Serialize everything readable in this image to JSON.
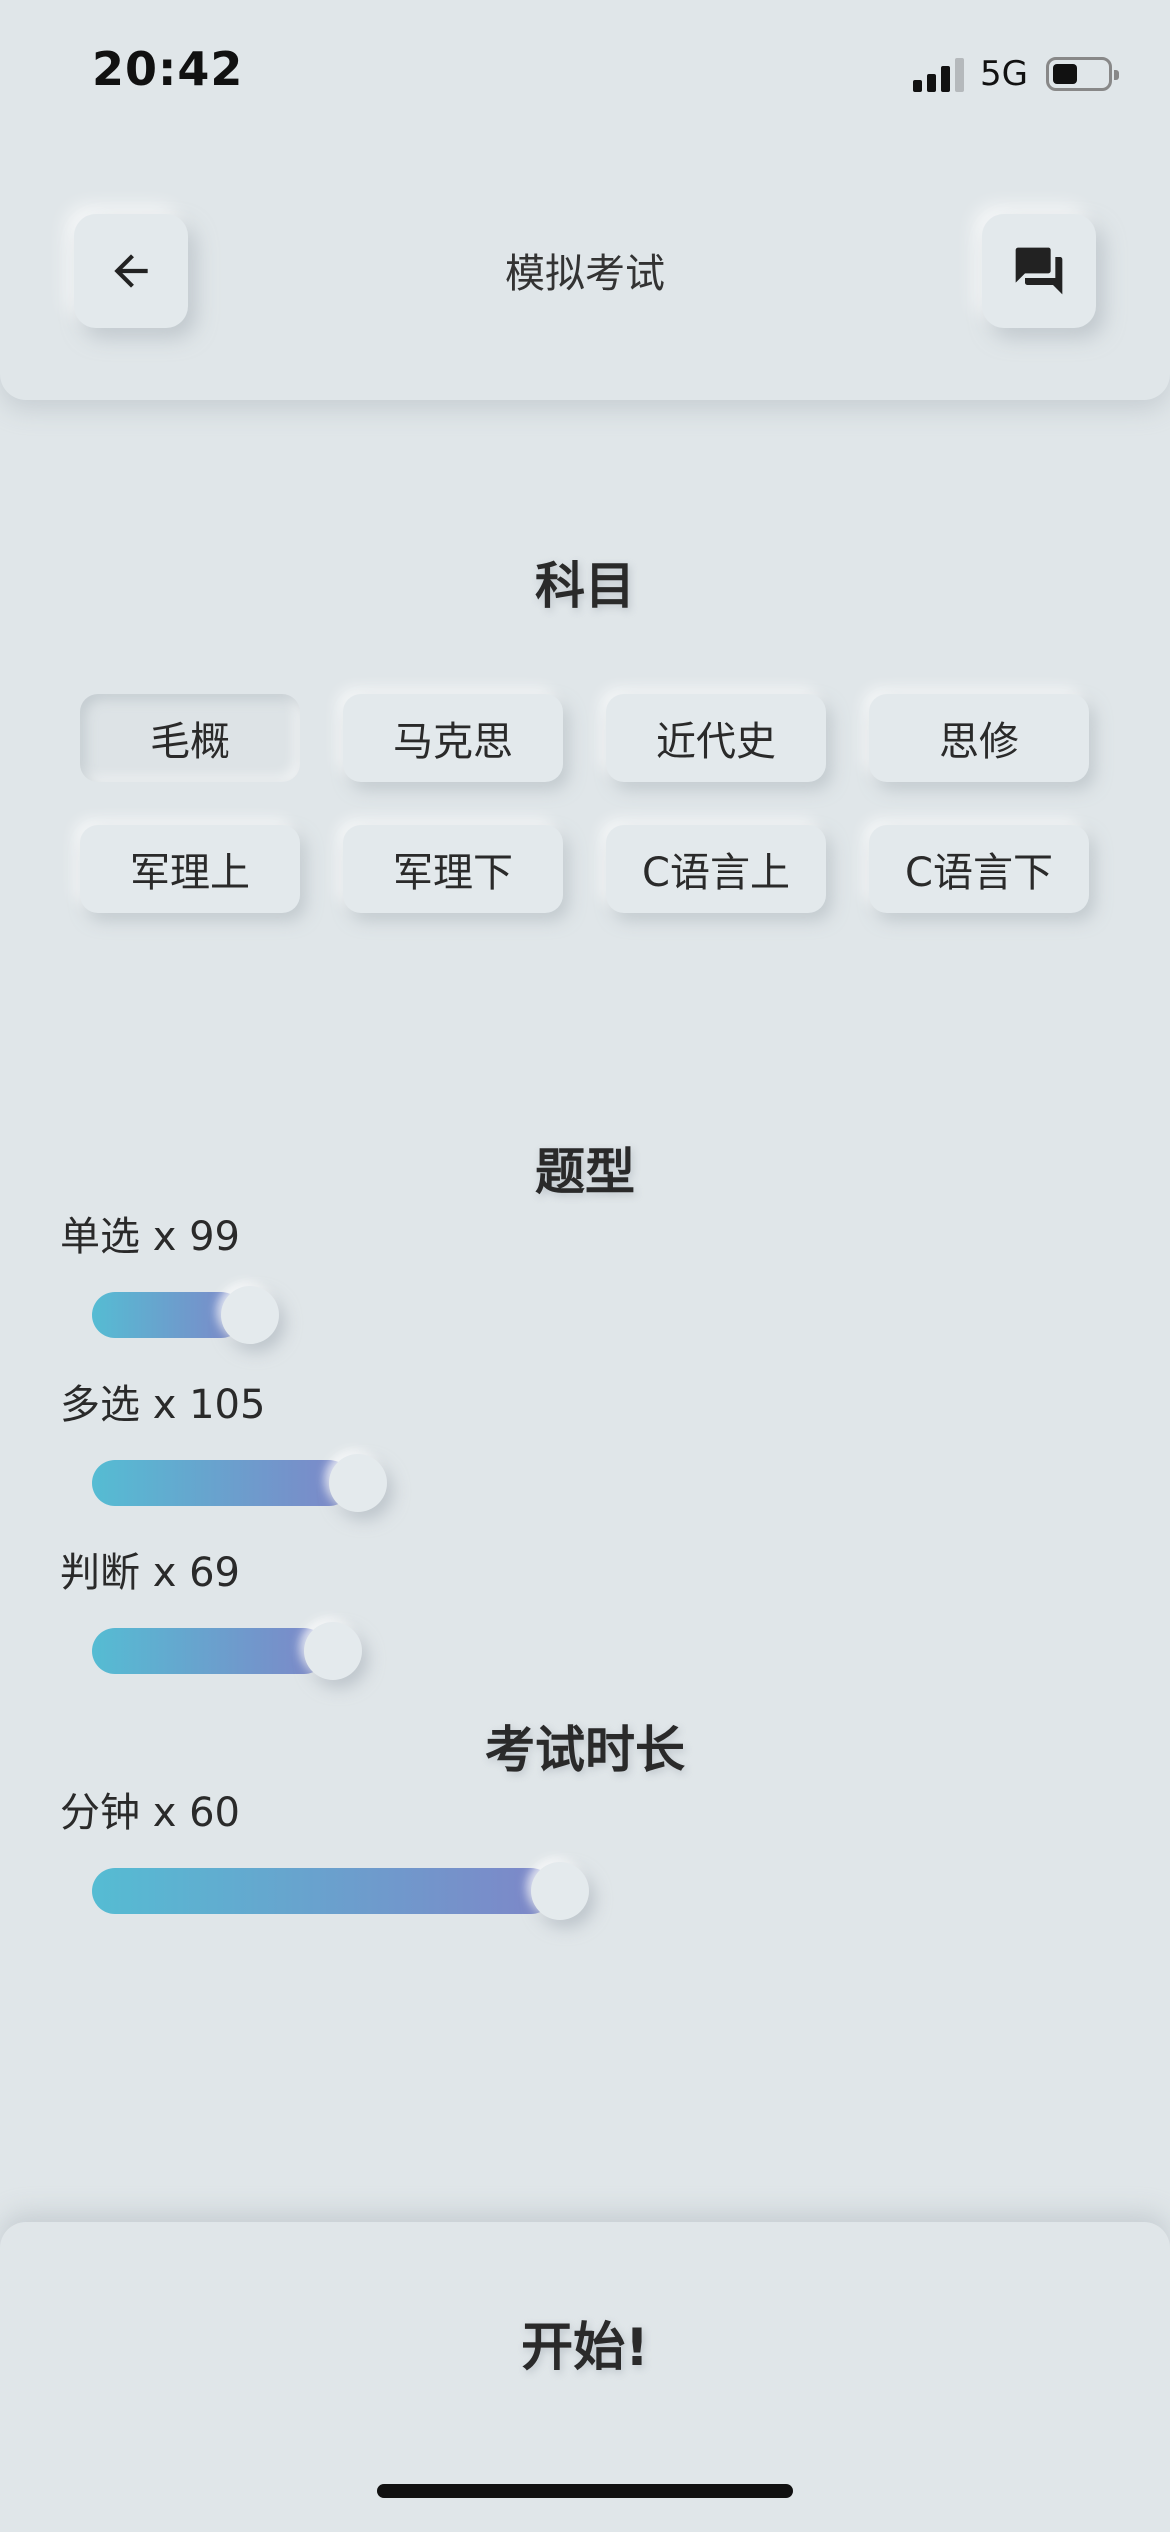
{
  "status_bar": {
    "time": "20:42",
    "network": "5G",
    "signal_bars": 4,
    "signal_active": 3,
    "battery_level": 0.45
  },
  "header": {
    "title": "模拟考试",
    "back_icon": "arrow-left-icon",
    "chat_icon": "chat-bubbles-icon"
  },
  "subject_section": {
    "title": "科目",
    "subjects": [
      {
        "label": "毛概",
        "selected": true
      },
      {
        "label": "马克思",
        "selected": false
      },
      {
        "label": "近代史",
        "selected": false
      },
      {
        "label": "思修",
        "selected": false
      },
      {
        "label": "军理上",
        "selected": false
      },
      {
        "label": "军理下",
        "selected": false
      },
      {
        "label": "C语言上",
        "selected": false
      },
      {
        "label": "C语言下",
        "selected": false
      }
    ]
  },
  "question_type_section": {
    "title": "题型",
    "sliders": [
      {
        "label": "单选 x 99",
        "fill_fraction": 0.165
      },
      {
        "label": "多选 x 105",
        "fill_fraction": 0.283
      },
      {
        "label": "判断 x 69",
        "fill_fraction": 0.255
      }
    ]
  },
  "duration_section": {
    "title": "考试时长",
    "slider": {
      "label": "分钟 x 60",
      "fill_fraction": 0.502
    }
  },
  "footer": {
    "start_label": "开始!"
  },
  "colors": {
    "background": "#e0e6e9",
    "slider_gradient_start": "#55bcd3",
    "slider_gradient_end": "#7e86c8"
  }
}
